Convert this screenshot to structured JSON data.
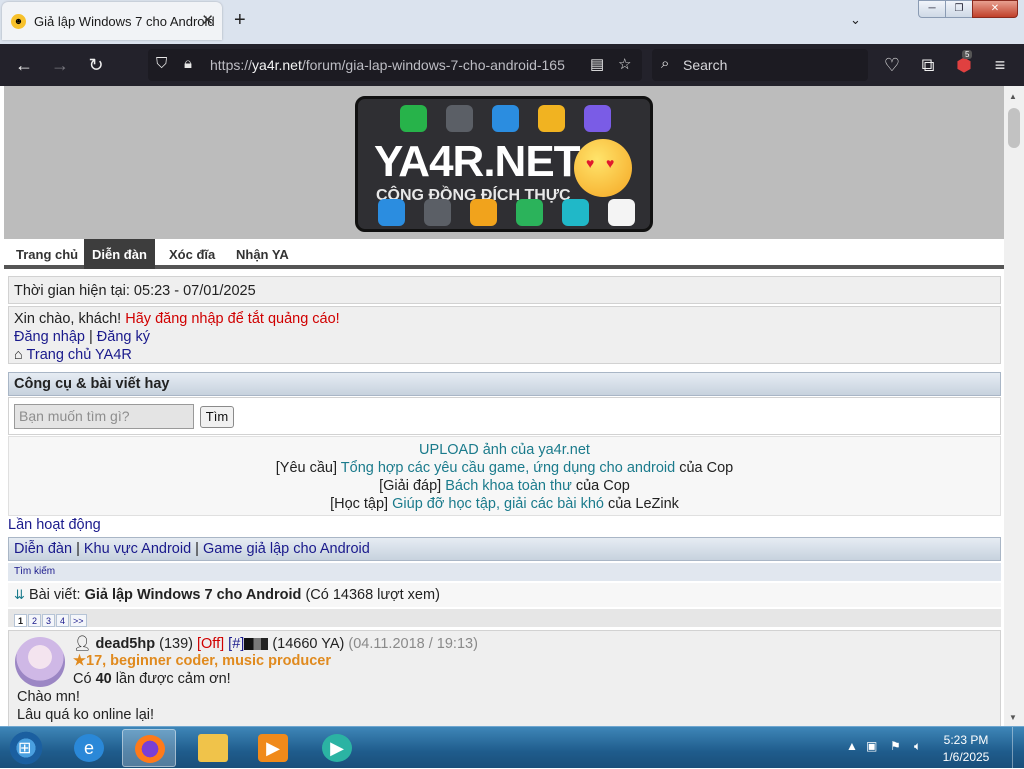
{
  "browser": {
    "tab_title": "Giả lập Windows 7 cho Android",
    "new_tab": "+",
    "url_prefix": "https://",
    "url_domain": "ya4r.net",
    "url_path": "/forum/gia-lap-windows-7-cho-android-165",
    "search_placeholder": "Search",
    "extension_badge": "5"
  },
  "header": {
    "brand": "YA4R.NET",
    "slogan": "CỘNG ĐỒNG ĐÍCH THỰC"
  },
  "menu": [
    "Trang chủ",
    "Diễn đàn",
    "Xóc đĩa",
    "Nhận YA"
  ],
  "time_line": "Thời gian hiện tại: 05:23 - 07/01/2025",
  "guest": {
    "greeting": "Xin chào, khách!",
    "warning": "Hãy đăng nhập để tắt quảng cáo!",
    "login": "Đăng nhập",
    "sep": "|",
    "register": "Đăng ký",
    "home": "Trang chủ YA4R"
  },
  "tools": {
    "title": "Công cụ & bài viết hay",
    "search_placeholder": "Bạn muốn tìm gì?",
    "search_button": "Tìm"
  },
  "featured": [
    {
      "prefix": "",
      "link": "UPLOAD ảnh của ya4r.net",
      "suffix": ""
    },
    {
      "prefix": "[Yêu cầu] ",
      "link": "Tổng hợp các yêu cầu game, ứng dụng cho android",
      "suffix": " của Cop"
    },
    {
      "prefix": "[Giải đáp] ",
      "link": "Bách khoa toàn thư",
      "suffix": " của Cop"
    },
    {
      "prefix": "[Học tập] ",
      "link": "Giúp đỡ học tập, giải các bài khó",
      "suffix": " của LeZink"
    }
  ],
  "activity": "Lần hoạt động",
  "breadcrumb": [
    "Diễn đàn",
    "Khu vực Android",
    "Game giả lập cho Android"
  ],
  "breadcrumb_sep": "|",
  "small_search": "Tìm kiếm",
  "post_title": {
    "label": "Bài viết:",
    "name": "Giả lập Windows 7 cho Android",
    "views": "(Có 14368 lượt xem)"
  },
  "pages": [
    "1",
    "2",
    "3",
    "4",
    ">>"
  ],
  "post": {
    "username": "dead5hp",
    "posts": "(139)",
    "status": "[Off]",
    "hash": "[#]",
    "ya": "(14660 YA)",
    "date": "(04.11.2018 / 19:13)",
    "rank": "17, beginner coder, music producer",
    "thanks_prefix": "Có",
    "thanks_count": "40",
    "thanks_suffix": "lần được cảm ơn!",
    "line1": "Chào mn!",
    "line2": "Lâu quá ko online lại!"
  },
  "taskbar": {
    "time": "5:23 PM",
    "date": "1/6/2025"
  }
}
